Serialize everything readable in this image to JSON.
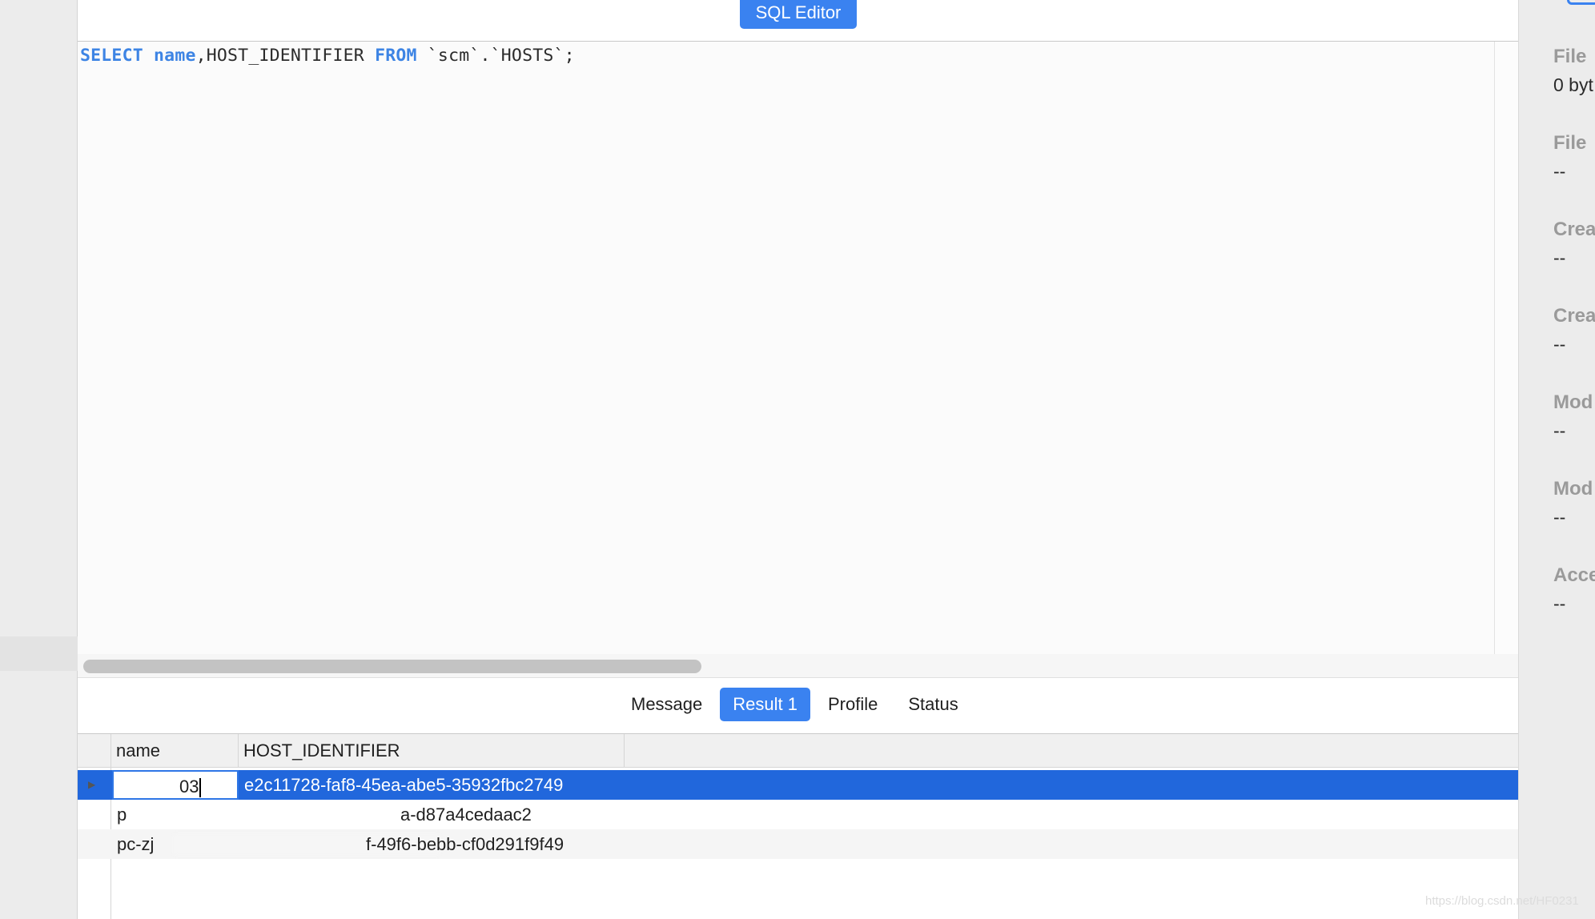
{
  "toolbar": {
    "title": "SQL Editor"
  },
  "editor": {
    "kw_select": "SELECT",
    "col_name": "name",
    "rest1": ",HOST_IDENTIFIER ",
    "kw_from": "FROM",
    "rest2": " `scm`.`HOSTS`;"
  },
  "tabs": [
    {
      "label": "Message"
    },
    {
      "label": "Result 1",
      "active": true
    },
    {
      "label": "Profile"
    },
    {
      "label": "Status"
    }
  ],
  "grid": {
    "columns": [
      "name",
      "HOST_IDENTIFIER"
    ],
    "rows": [
      {
        "name": "03",
        "host_identifier": "e2c11728-faf8-45ea-abe5-35932fbc2749"
      },
      {
        "name": "p",
        "host_identifier": "a-d87a4cedaac2"
      },
      {
        "name": "pc-zj",
        "host_identifier": "f-49f6-bebb-cf0d291f9f49"
      }
    ],
    "row_indicator": "▶"
  },
  "info_panel": {
    "items": [
      {
        "label": "File",
        "value": "0 byt"
      },
      {
        "label": "File",
        "value": "--"
      },
      {
        "label": "Crea",
        "value": "--"
      },
      {
        "label": "Crea",
        "value": "--"
      },
      {
        "label": "Mod",
        "value": "--"
      },
      {
        "label": "Mod",
        "value": "--"
      },
      {
        "label": "Acce",
        "value": "--"
      }
    ]
  },
  "watermark": "https://blog.csdn.net/HF0231",
  "colors": {
    "accent": "#3a82f0",
    "selection": "#2167dc",
    "keyword": "#3d84e4"
  }
}
